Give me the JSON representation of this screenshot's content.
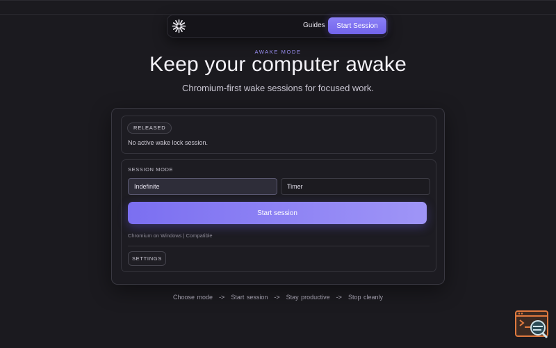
{
  "nav": {
    "guides_label": "Guides",
    "start_label": "Start Session"
  },
  "hero": {
    "eyebrow": "AWAKE MODE",
    "title": "Keep your computer awake",
    "subtitle": "Chromium-first wake sessions for focused work."
  },
  "status": {
    "badge": "RELEASED",
    "text": "No active wake lock session."
  },
  "session": {
    "mode_label": "SESSION MODE",
    "modes": [
      "Indefinite",
      "Timer"
    ],
    "selected_mode": "Indefinite",
    "start_label": "Start session",
    "compat_text": "Chromium on Windows | Compatible",
    "settings_label": "SETTINGS"
  },
  "flow": {
    "steps": [
      "Choose mode",
      "Start session",
      "Stay productive",
      "Stop cleanly"
    ],
    "separator": "->"
  },
  "colors": {
    "accent": "#7b6ff1",
    "background": "#1b1a1f",
    "corner_widget": "#e07a3f"
  }
}
